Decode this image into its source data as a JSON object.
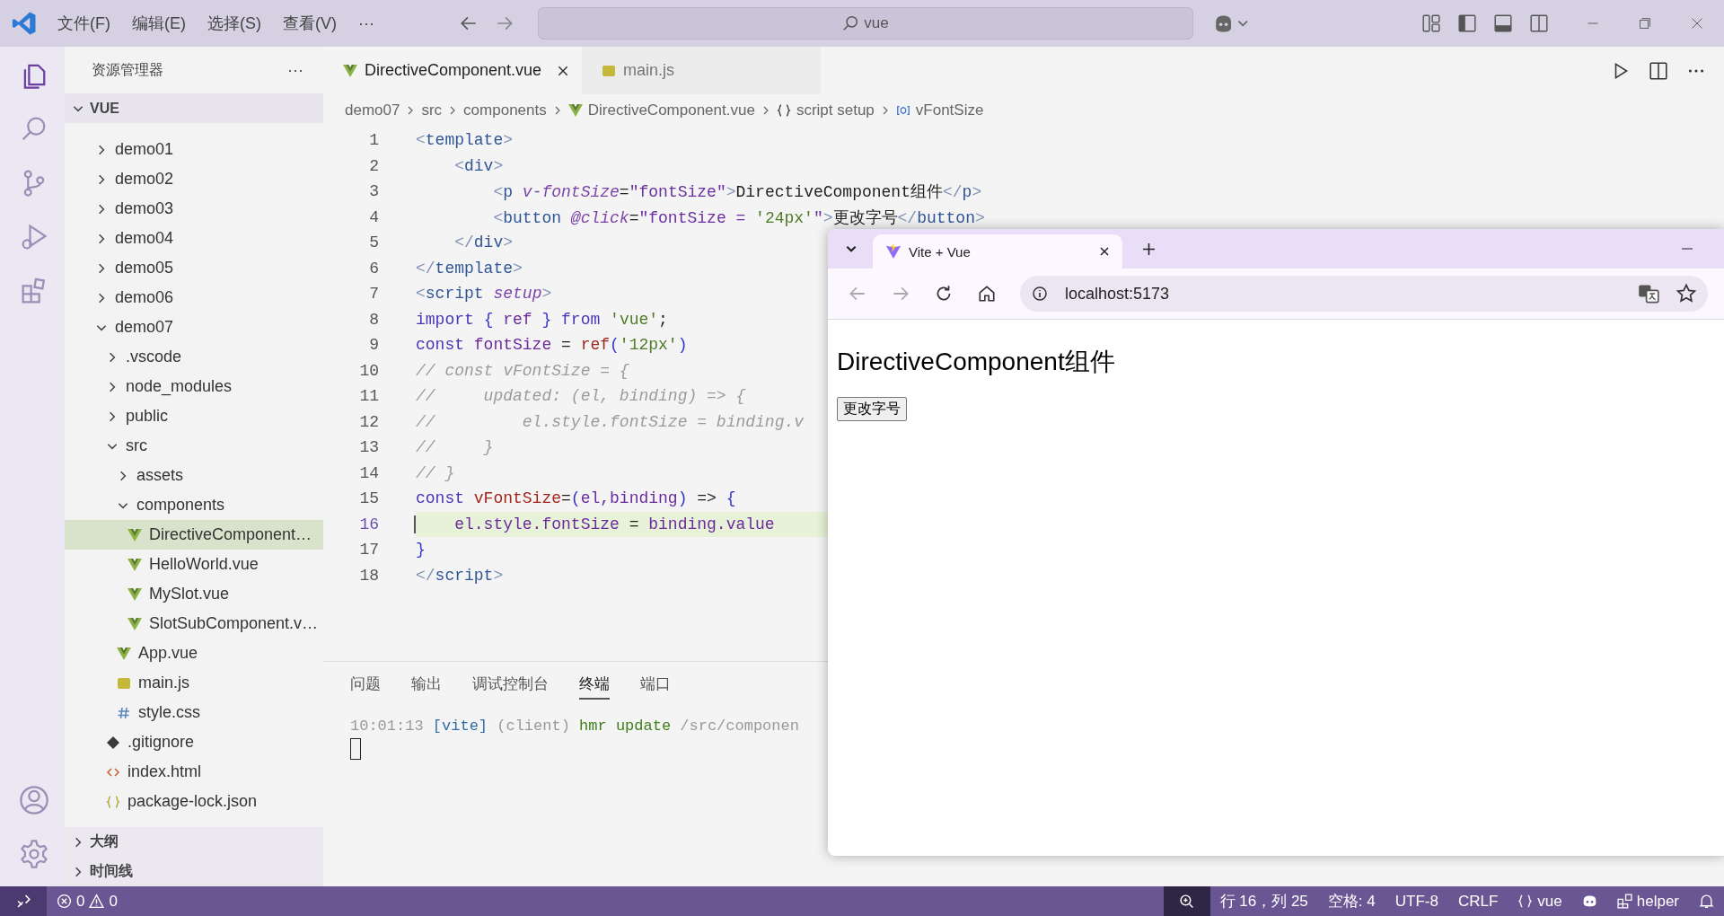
{
  "title_bar": {
    "menus": [
      "文件(F)",
      "编辑(E)",
      "选择(S)",
      "查看(V)",
      "···"
    ],
    "search": {
      "value": "vue"
    }
  },
  "sidebar": {
    "title": "资源管理器",
    "more": "···",
    "section": "VUE",
    "tree": [
      {
        "name": "demo01",
        "kind": "folder",
        "expanded": false,
        "selected": false
      },
      {
        "name": "demo02",
        "kind": "folder",
        "expanded": false,
        "selected": false
      },
      {
        "name": "demo03",
        "kind": "folder",
        "expanded": false,
        "selected": false
      },
      {
        "name": "demo04",
        "kind": "folder",
        "expanded": false,
        "selected": false
      },
      {
        "name": "demo05",
        "kind": "folder",
        "expanded": false,
        "selected": false
      },
      {
        "name": "demo06",
        "kind": "folder",
        "expanded": false,
        "selected": false
      },
      {
        "name": "demo07",
        "kind": "folder",
        "expanded": true,
        "selected": false,
        "children": [
          {
            "name": ".vscode",
            "kind": "folder",
            "expanded": false,
            "selected": false
          },
          {
            "name": "node_modules",
            "kind": "folder",
            "expanded": false,
            "selected": false
          },
          {
            "name": "public",
            "kind": "folder",
            "expanded": false,
            "selected": false
          },
          {
            "name": "src",
            "kind": "folder",
            "expanded": true,
            "selected": false,
            "children": [
              {
                "name": "assets",
                "kind": "folder",
                "expanded": false,
                "selected": false
              },
              {
                "name": "components",
                "kind": "folder",
                "expanded": true,
                "selected": false,
                "children": [
                  {
                    "name": "DirectiveComponent…",
                    "kind": "vue",
                    "selected": true
                  },
                  {
                    "name": "HelloWorld.vue",
                    "kind": "vue",
                    "selected": false
                  },
                  {
                    "name": "MySlot.vue",
                    "kind": "vue",
                    "selected": false
                  },
                  {
                    "name": "SlotSubComponent.v…",
                    "kind": "vue",
                    "selected": false
                  }
                ]
              },
              {
                "name": "App.vue",
                "kind": "vue",
                "selected": false
              },
              {
                "name": "main.js",
                "kind": "js",
                "selected": false
              },
              {
                "name": "style.css",
                "kind": "css",
                "selected": false
              }
            ]
          },
          {
            "name": ".gitignore",
            "kind": "git",
            "selected": false
          },
          {
            "name": "index.html",
            "kind": "html",
            "selected": false
          },
          {
            "name": "package-lock.json",
            "kind": "json",
            "selected": false
          }
        ]
      }
    ],
    "bottom_sections": [
      "大纲",
      "时间线"
    ]
  },
  "editor": {
    "tabs": [
      {
        "label": "DirectiveComponent.vue",
        "kind": "vue",
        "selected": true
      },
      {
        "label": "main.js",
        "kind": "js",
        "selected": false
      }
    ],
    "breadcrumb": [
      {
        "label": "demo07",
        "kind": "text"
      },
      {
        "label": "src",
        "kind": "text"
      },
      {
        "label": "components",
        "kind": "text"
      },
      {
        "label": "DirectiveComponent.vue",
        "kind": "vue"
      },
      {
        "label": "script setup",
        "kind": "braces"
      },
      {
        "label": "vFontSize",
        "kind": "symbol"
      }
    ],
    "lines": [
      {
        "number": "1",
        "highlighted": false,
        "tokens": [
          {
            "kind": "punct",
            "text": "<"
          },
          {
            "kind": "tag",
            "text": "template"
          },
          {
            "kind": "punct",
            "text": ">"
          }
        ]
      },
      {
        "number": "2",
        "highlighted": false,
        "tokens": [
          {
            "kind": "punct",
            "text": "    <"
          },
          {
            "kind": "tag",
            "text": "div"
          },
          {
            "kind": "punct",
            "text": ">"
          }
        ]
      },
      {
        "number": "3",
        "highlighted": false,
        "tokens": [
          {
            "kind": "punct",
            "text": "        <"
          },
          {
            "kind": "tag",
            "text": "p "
          },
          {
            "kind": "attr",
            "text": "v-fontSize"
          },
          {
            "kind": "plain",
            "text": "="
          },
          {
            "kind": "value",
            "text": "\"fontSize\""
          },
          {
            "kind": "punct",
            "text": ">"
          },
          {
            "kind": "plain",
            "text": "DirectiveComponent组件"
          },
          {
            "kind": "punct",
            "text": "</"
          },
          {
            "kind": "tag",
            "text": "p"
          },
          {
            "kind": "punct",
            "text": ">"
          }
        ]
      },
      {
        "number": "4",
        "highlighted": false,
        "tokens": [
          {
            "kind": "punct",
            "text": "        <"
          },
          {
            "kind": "tag",
            "text": "button "
          },
          {
            "kind": "attr",
            "text": "@click"
          },
          {
            "kind": "plain",
            "text": "="
          },
          {
            "kind": "value",
            "text": "\"fontSize = "
          },
          {
            "kind": "string",
            "text": "'24px'"
          },
          {
            "kind": "value",
            "text": "\""
          },
          {
            "kind": "punct",
            "text": ">"
          },
          {
            "kind": "plain",
            "text": "更改字号"
          },
          {
            "kind": "punct",
            "text": "</"
          },
          {
            "kind": "tag",
            "text": "button"
          },
          {
            "kind": "punct",
            "text": ">"
          }
        ]
      },
      {
        "number": "5",
        "highlighted": false,
        "tokens": [
          {
            "kind": "punct",
            "text": "    </"
          },
          {
            "kind": "tag",
            "text": "div"
          },
          {
            "kind": "punct",
            "text": ">"
          }
        ]
      },
      {
        "number": "6",
        "highlighted": false,
        "tokens": [
          {
            "kind": "punct",
            "text": "</"
          },
          {
            "kind": "tag",
            "text": "template"
          },
          {
            "kind": "punct",
            "text": ">"
          }
        ]
      },
      {
        "number": "7",
        "highlighted": false,
        "tokens": [
          {
            "kind": "punct",
            "text": "<"
          },
          {
            "kind": "tag",
            "text": "script "
          },
          {
            "kind": "attr",
            "text": "setup"
          },
          {
            "kind": "punct",
            "text": ">"
          }
        ]
      },
      {
        "number": "8",
        "highlighted": false,
        "tokens": [
          {
            "kind": "keyword",
            "text": "import "
          },
          {
            "kind": "bracket",
            "text": "{ "
          },
          {
            "kind": "variable",
            "text": "ref "
          },
          {
            "kind": "bracket",
            "text": "} "
          },
          {
            "kind": "keyword",
            "text": "from "
          },
          {
            "kind": "string",
            "text": "'vue'"
          },
          {
            "kind": "plain",
            "text": ";"
          }
        ]
      },
      {
        "number": "9",
        "highlighted": false,
        "tokens": [
          {
            "kind": "keyword",
            "text": "const "
          },
          {
            "kind": "variable",
            "text": "fontSize"
          },
          {
            "kind": "plain",
            "text": " = "
          },
          {
            "kind": "function",
            "text": "ref"
          },
          {
            "kind": "bracket",
            "text": "("
          },
          {
            "kind": "string",
            "text": "'12px'"
          },
          {
            "kind": "bracket",
            "text": ")"
          }
        ]
      },
      {
        "number": "10",
        "highlighted": false,
        "tokens": [
          {
            "kind": "comment",
            "text": "// const vFontSize = {"
          }
        ]
      },
      {
        "number": "11",
        "highlighted": false,
        "tokens": [
          {
            "kind": "comment",
            "text": "//     updated: (el, binding) => {"
          }
        ]
      },
      {
        "number": "12",
        "highlighted": false,
        "tokens": [
          {
            "kind": "comment",
            "text": "//         el.style.fontSize = binding.v"
          }
        ]
      },
      {
        "number": "13",
        "highlighted": false,
        "tokens": [
          {
            "kind": "comment",
            "text": "//     }"
          }
        ]
      },
      {
        "number": "14",
        "highlighted": false,
        "tokens": [
          {
            "kind": "comment",
            "text": "// }"
          }
        ]
      },
      {
        "number": "15",
        "highlighted": false,
        "tokens": [
          {
            "kind": "keyword",
            "text": "const "
          },
          {
            "kind": "function",
            "text": "vFontSize"
          },
          {
            "kind": "plain",
            "text": "="
          },
          {
            "kind": "bracket",
            "text": "("
          },
          {
            "kind": "variable",
            "text": "el,binding"
          },
          {
            "kind": "bracket",
            "text": ")"
          },
          {
            "kind": "plain",
            "text": " => "
          },
          {
            "kind": "bracket",
            "text": "{"
          }
        ]
      },
      {
        "number": "16",
        "highlighted": true,
        "tokens": [
          {
            "kind": "variable",
            "text": "    el.style.fontSize"
          },
          {
            "kind": "plain",
            "text": " = "
          },
          {
            "kind": "variable",
            "text": "binding.value"
          }
        ]
      },
      {
        "number": "17",
        "highlighted": false,
        "tokens": [
          {
            "kind": "bracket",
            "text": "}"
          }
        ]
      },
      {
        "number": "18",
        "highlighted": false,
        "tokens": [
          {
            "kind": "punct",
            "text": "</"
          },
          {
            "kind": "tag",
            "text": "script"
          },
          {
            "kind": "punct",
            "text": ">"
          }
        ]
      }
    ]
  },
  "panel": {
    "tabs": [
      {
        "label": "问题",
        "selected": false
      },
      {
        "label": "输出",
        "selected": false
      },
      {
        "label": "调试控制台",
        "selected": false
      },
      {
        "label": "终端",
        "selected": true
      },
      {
        "label": "端口",
        "selected": false
      }
    ],
    "terminal": [
      {
        "kind": "time",
        "text": "10:01:13 "
      },
      {
        "kind": "tag",
        "text": "[vite]"
      },
      {
        "kind": "dim",
        "text": " (client) "
      },
      {
        "kind": "green",
        "text": "hmr update "
      },
      {
        "kind": "dim",
        "text": "/src/componen"
      }
    ]
  },
  "browser": {
    "tab_title": "Vite + Vue",
    "address": "localhost:5173",
    "heading": "DirectiveComponent组件",
    "button": "更改字号"
  },
  "status_bar": {
    "errors": "0",
    "warnings": "0",
    "position": "行 16，列 25",
    "indentation": "空格: 4",
    "encoding": "UTF-8",
    "line_ending": "CRLF",
    "language": "vue",
    "extension": "helper"
  }
}
